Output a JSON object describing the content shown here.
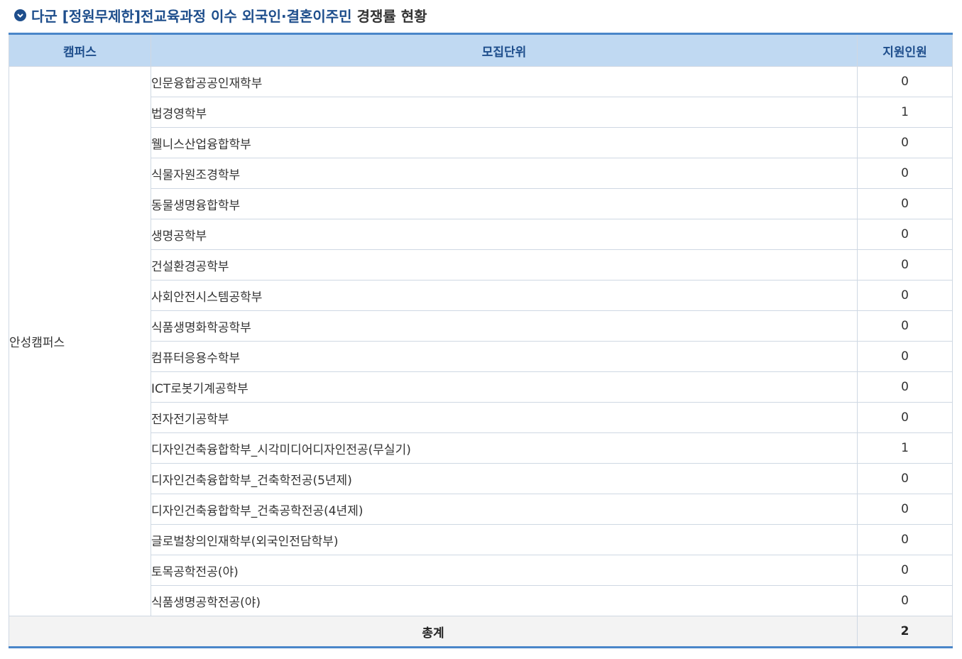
{
  "title": {
    "highlight": "다군 [정원무제한]전교육과정 이수 외국인·결혼이주민",
    "rest": "경쟁률 현황",
    "icon": "check-circle-icon",
    "accent_color": "#1e4e8c"
  },
  "table": {
    "headers": {
      "campus": "캠퍼스",
      "unit": "모집단위",
      "applicants": "지원인원"
    },
    "campus": "안성캠퍼스",
    "rows": [
      {
        "unit": "인문융합공공인재학부",
        "count": "0"
      },
      {
        "unit": "법경영학부",
        "count": "1"
      },
      {
        "unit": "웰니스산업융합학부",
        "count": "0"
      },
      {
        "unit": "식물자원조경학부",
        "count": "0"
      },
      {
        "unit": "동물생명융합학부",
        "count": "0"
      },
      {
        "unit": "생명공학부",
        "count": "0"
      },
      {
        "unit": "건설환경공학부",
        "count": "0"
      },
      {
        "unit": "사회안전시스템공학부",
        "count": "0"
      },
      {
        "unit": "식품생명화학공학부",
        "count": "0"
      },
      {
        "unit": "컴퓨터응용수학부",
        "count": "0"
      },
      {
        "unit": "ICT로봇기계공학부",
        "count": "0"
      },
      {
        "unit": "전자전기공학부",
        "count": "0"
      },
      {
        "unit": "디자인건축융합학부_시각미디어디자인전공(무실기)",
        "count": "1"
      },
      {
        "unit": "디자인건축융합학부_건축학전공(5년제)",
        "count": "0"
      },
      {
        "unit": "디자인건축융합학부_건축공학전공(4년제)",
        "count": "0"
      },
      {
        "unit": "글로벌창의인재학부(외국인전담학부)",
        "count": "0"
      },
      {
        "unit": "토목공학전공(야)",
        "count": "0"
      },
      {
        "unit": "식품생명공학전공(야)",
        "count": "0"
      }
    ],
    "total_label": "총계",
    "total_count": "2"
  }
}
